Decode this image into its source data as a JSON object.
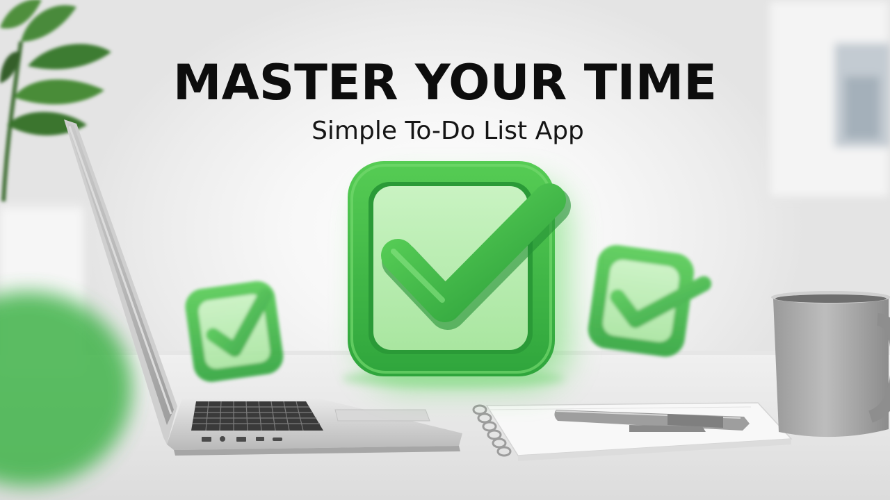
{
  "headline": "MASTER YOUR TIME",
  "subheadline": "Simple To-Do List App",
  "colors": {
    "accent_green": "#3fbf4a",
    "accent_green_dark": "#23993a",
    "accent_green_light": "#b8eeb0",
    "headline_text": "#0d0d0d",
    "background": "#efefef"
  },
  "icons": {
    "main": "checkbox-checked-icon",
    "secondary_left": "checkbox-checked-icon",
    "secondary_right": "checkbox-checked-icon"
  }
}
